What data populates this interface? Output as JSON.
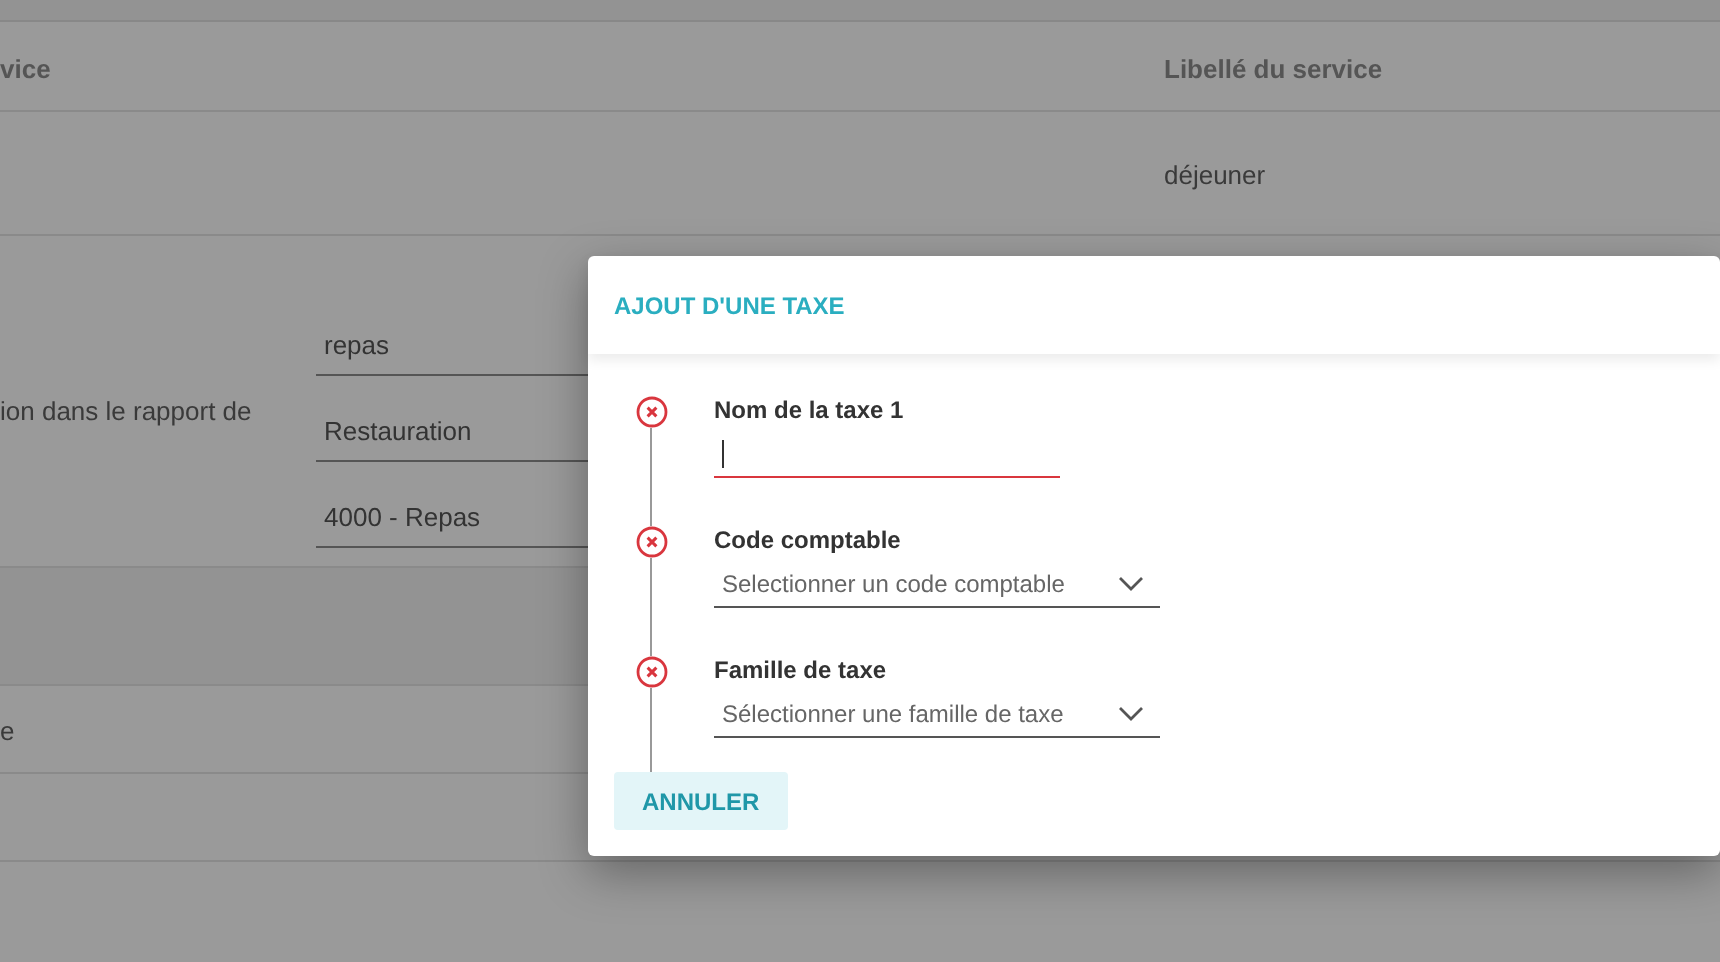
{
  "table": {
    "columns": [
      "vice",
      "Libellé du service"
    ],
    "rows": [
      [
        "",
        "déjeuner"
      ]
    ]
  },
  "section": {
    "label": "ion dans le rapport de",
    "fields": [
      "repas",
      "Restauration",
      "4000 - Repas"
    ]
  },
  "lower_rows": [
    "e",
    ""
  ],
  "dialog": {
    "title": "AJOUT D'UNE TAXE",
    "steps": [
      {
        "kind": "text",
        "label": "Nom de la taxe 1",
        "error": true,
        "focused": true
      },
      {
        "kind": "select",
        "label": "Code comptable",
        "placeholder": "Selectionner un code comptable",
        "error": true
      },
      {
        "kind": "select",
        "label": "Famille de taxe",
        "placeholder": "Sélectionner une famille de taxe",
        "error": true
      }
    ],
    "buttons": [
      "ANNULER"
    ]
  }
}
